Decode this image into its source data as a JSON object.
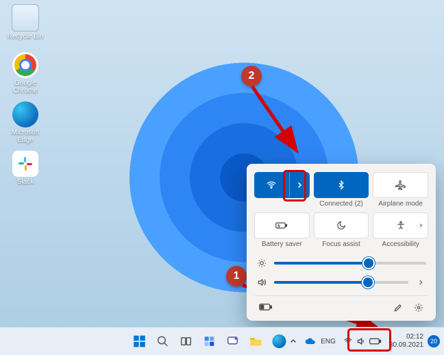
{
  "desktop_icons": [
    {
      "label": "Recycle Bin"
    },
    {
      "label": "Google Chrome"
    },
    {
      "label": "Microsoft Edge"
    },
    {
      "label": "Slack"
    }
  ],
  "panel": {
    "tiles": [
      {
        "id": "wifi",
        "label": "",
        "active": true,
        "expandable": true
      },
      {
        "id": "bluetooth",
        "label": "Connected (2)",
        "active": true
      },
      {
        "id": "airplane",
        "label": "Airplane mode",
        "active": false
      },
      {
        "id": "battery-saver",
        "label": "Battery saver",
        "active": false
      },
      {
        "id": "focus-assist",
        "label": "Focus assist",
        "active": false
      },
      {
        "id": "accessibility",
        "label": "Accessibility",
        "active": false,
        "expandable": true
      }
    ],
    "brightness_percent": 62,
    "volume_percent": 70
  },
  "tray": {
    "language": "ENG",
    "time": "02:12",
    "date": "30.09.2021",
    "notification_count": "20"
  },
  "annotations": [
    {
      "num": "1",
      "target": "tray-network-volume-battery"
    },
    {
      "num": "2",
      "target": "wifi-expand-button"
    }
  ],
  "colors": {
    "accent": "#0067c0",
    "annotation": "#d40000",
    "panel_bg": "#f5f3f1"
  }
}
